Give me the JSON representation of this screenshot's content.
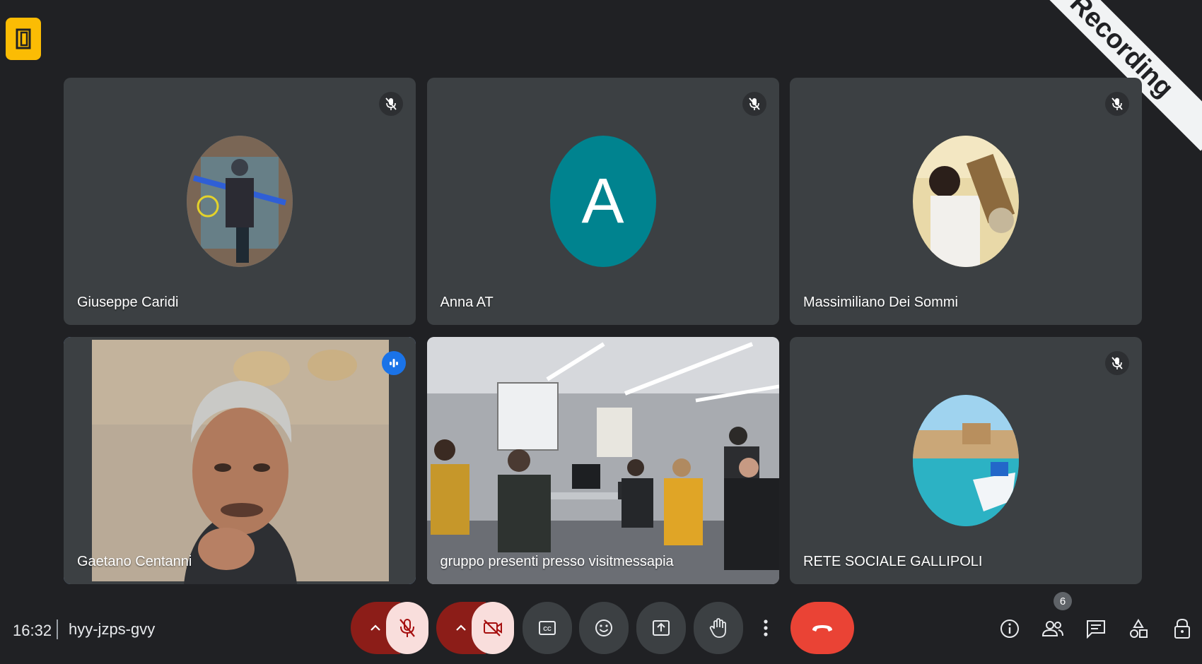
{
  "window": {
    "recording_label": "Recording"
  },
  "participants": [
    {
      "name": "Giuseppe Caridi",
      "muted": true,
      "avatar": "photo-diver"
    },
    {
      "name": "Anna AT",
      "muted": true,
      "avatar_letter": "A"
    },
    {
      "name": "Massimiliano Dei Sommi",
      "muted": true,
      "avatar": "photo-man-drinking"
    },
    {
      "name": "Gaetano Centanni",
      "speaking": true,
      "video": "man-face"
    },
    {
      "name": "gruppo presenti presso visitmessapia",
      "video": "group-room"
    },
    {
      "name": "RETE SOCIALE GALLIPOLI",
      "muted": true,
      "avatar": "photo-coastal-town"
    }
  ],
  "footer": {
    "time": "16:32",
    "meeting_code": "hyy-jzps-gvy",
    "people_count": "6"
  },
  "colors": {
    "background": "#202124",
    "tile": "#3c4043",
    "active_outline": "#8ab4f8",
    "end_call": "#ea4335",
    "muted_toggle": "#f9dedc",
    "companion": "#fbbc04"
  }
}
